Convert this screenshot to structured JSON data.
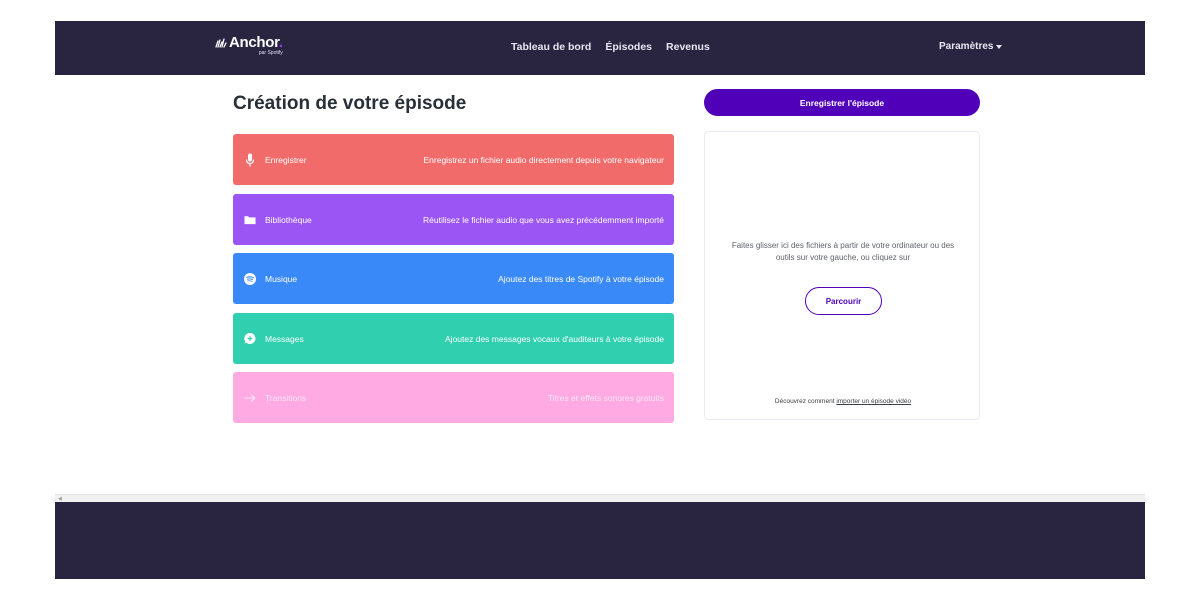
{
  "brand": {
    "name": "Anchor",
    "dot": ".",
    "sub": "par Spotify"
  },
  "nav": {
    "items": [
      {
        "label": "Tableau de bord"
      },
      {
        "label": "Épisodes"
      },
      {
        "label": "Revenus"
      }
    ]
  },
  "settings": {
    "label": "Paramètres"
  },
  "page": {
    "title": "Création de votre épisode"
  },
  "tools": [
    {
      "label": "Enregistrer",
      "desc": "Enregistrez un fichier audio directement depuis votre navigateur",
      "icon": "microphone-icon",
      "color": "#f26b6b"
    },
    {
      "label": "Bibliothèque",
      "desc": "Réutilisez le fichier audio que vous avez précédemment importé",
      "icon": "folder-icon",
      "color": "#9b55f5"
    },
    {
      "label": "Musique",
      "desc": "Ajoutez des titres de Spotify à votre épisode",
      "icon": "spotify-icon",
      "color": "#3a89f8"
    },
    {
      "label": "Messages",
      "desc": "Ajoutez des messages vocaux d'auditeurs à votre épisode",
      "icon": "message-icon",
      "color": "#2fcfaf"
    },
    {
      "label": "Transitions",
      "desc": "Titres et effets sonores gratuits",
      "icon": "arrow-right-icon",
      "color": "#ffaae3"
    }
  ],
  "record_button": {
    "label": "Enregistrer l'épisode",
    "color": "#5000b9"
  },
  "dropzone": {
    "instructions": "Faites glisser ici des fichiers à partir de votre ordinateur ou des outils sur votre gauche, ou cliquez sur",
    "browse_label": "Parcourir",
    "footer_prefix": "Découvrez comment",
    "footer_link": "importer un épisode vidéo"
  }
}
